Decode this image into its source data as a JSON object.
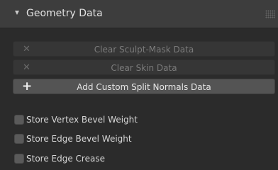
{
  "panel": {
    "title": "Geometry Data"
  },
  "buttons": [
    {
      "label": "Clear Sculpt-Mask Data",
      "icon": "x-icon",
      "enabled": false
    },
    {
      "label": "Clear Skin Data",
      "icon": "x-icon",
      "enabled": false
    },
    {
      "label": "Add Custom Split Normals Data",
      "icon": "plus-icon",
      "enabled": true
    }
  ],
  "checkboxes": [
    {
      "label": "Store Vertex Bevel Weight",
      "checked": false
    },
    {
      "label": "Store Edge Bevel Weight",
      "checked": false
    },
    {
      "label": "Store Edge Crease",
      "checked": false
    }
  ],
  "icons": {
    "collapse": "triangle-down-icon",
    "drag": "grip-dots-icon"
  },
  "colors": {
    "panel_bg": "#2b2b2b",
    "header_bg": "#3d3d3d",
    "button_active_bg": "#545454",
    "button_disabled_bg": "#363636"
  }
}
